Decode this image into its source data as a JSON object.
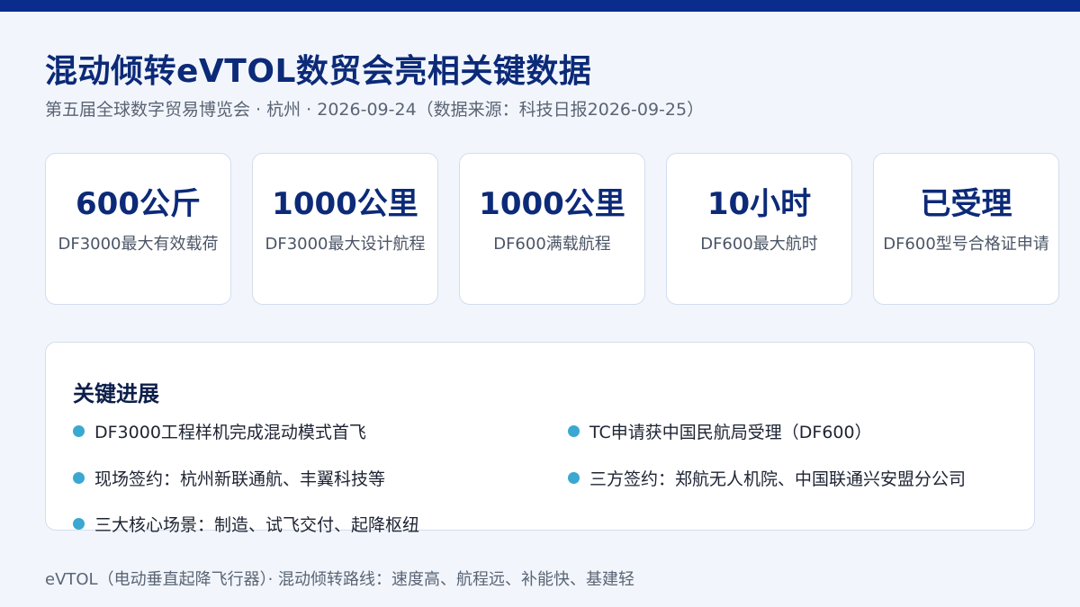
{
  "header": {
    "title": "混动倾转eVTOL数贸会亮相关键数据",
    "subtitle": "第五届全球数字贸易博览会 · 杭州 · 2026-09-24（数据来源：科技日报2026-09-25）"
  },
  "stats": [
    {
      "value": "600公斤",
      "label": "DF3000最大有效载荷"
    },
    {
      "value": "1000公里",
      "label": "DF3000最大设计航程"
    },
    {
      "value": "1000公里",
      "label": "DF600满载航程"
    },
    {
      "value": "10小时",
      "label": "DF600最大航时"
    },
    {
      "value": "已受理",
      "label": "DF600型号合格证申请"
    }
  ],
  "progress": {
    "title": "关键进展",
    "items": [
      "DF3000工程样机完成混动模式首飞",
      "TC申请获中国民航局受理（DF600）",
      "现场签约：杭州新联通航、丰翼科技等",
      "三方签约：郑航无人机院、中国联通兴安盟分公司",
      "三大核心场景：制造、试飞交付、起降枢纽"
    ]
  },
  "footer": {
    "text": "eVTOL（电动垂直起降飞行器）· 混动倾转路线：速度高、航程远、补能快、基建轻"
  },
  "colors": {
    "top_bar": "#0a2c8c",
    "title": "#0c2a78",
    "bullet": "#3aa8d0",
    "background": "#f2f6fc"
  }
}
